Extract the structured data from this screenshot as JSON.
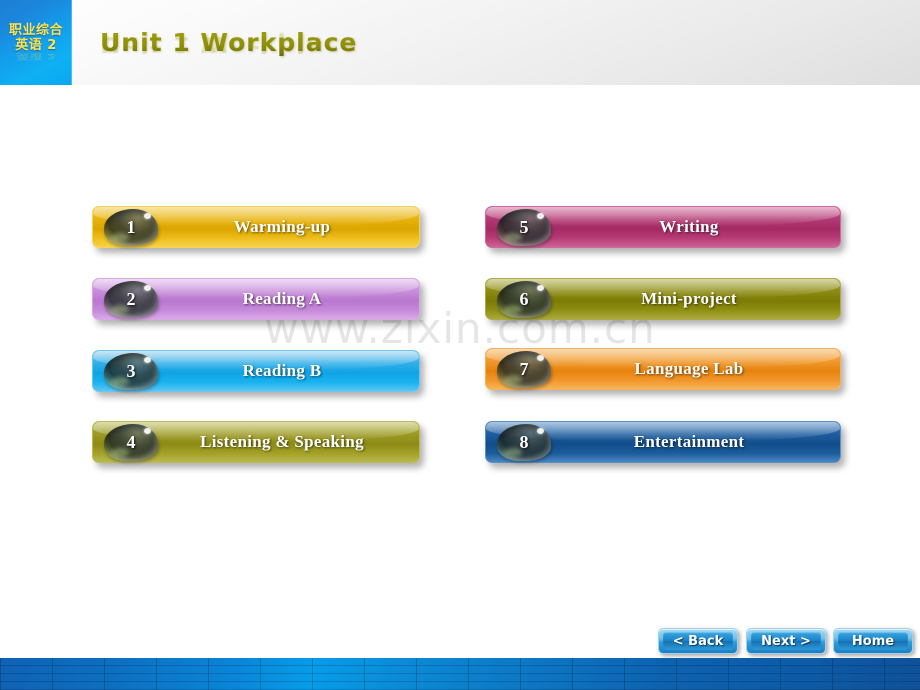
{
  "header": {
    "logo_line1": "职业综合",
    "logo_line2": "英语 2",
    "title": "Unit 1  Workplace",
    "logo_bg_color": "#0fa0ec",
    "title_color": "#8a8a09"
  },
  "watermark": {
    "text": "www.zixin.com.cn"
  },
  "menu": {
    "left_column": [
      {
        "number": "1",
        "label": "Warming-up",
        "color": "#e0a800",
        "accent": "#f5c400"
      },
      {
        "number": "2",
        "label": "Reading A",
        "color": "#b977cf",
        "accent": "#c98ddd"
      },
      {
        "number": "3",
        "label": "Reading B",
        "color": "#10a0e0",
        "accent": "#2fb6ef"
      },
      {
        "number": "4",
        "label": "Listening & Speaking",
        "color": "#8f8f1e",
        "accent": "#a5a52d"
      }
    ],
    "right_column": [
      {
        "number": "5",
        "label": "Writing",
        "color": "#ab2d68",
        "accent": "#bf3e7c"
      },
      {
        "number": "6",
        "label": "Mini-project",
        "color": "#7e7d07",
        "accent": "#92910f"
      },
      {
        "number": "7",
        "label": "Language Lab",
        "color": "#e8820f",
        "accent": "#f59a22"
      },
      {
        "number": "8",
        "label": "Entertainment",
        "color": "#13508f",
        "accent": "#2068b3"
      }
    ]
  },
  "navigation": {
    "back_label": "< Back",
    "next_label": "Next >",
    "home_label": "Home"
  },
  "footer": {
    "bar_color": "#0a86d8"
  }
}
